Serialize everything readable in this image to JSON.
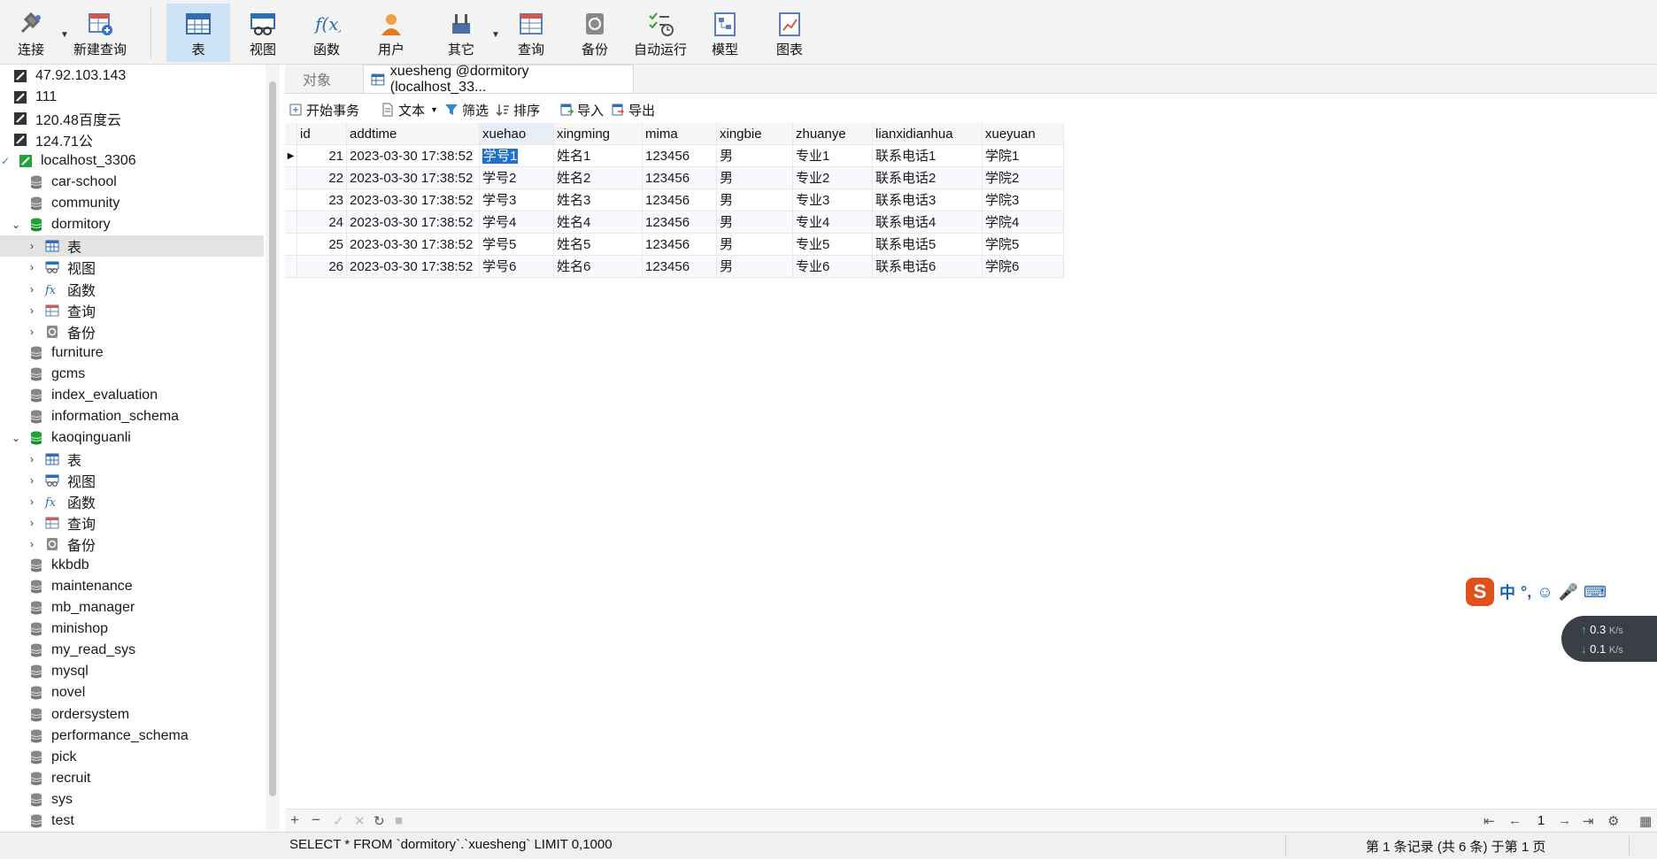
{
  "toolbar": {
    "connect": "连接",
    "new_query": "新建查询",
    "table": "表",
    "view": "视图",
    "function": "函数",
    "user": "用户",
    "other": "其它",
    "query": "查询",
    "backup": "备份",
    "autorun": "自动运行",
    "model": "模型",
    "chart": "图表"
  },
  "tree": {
    "items": [
      {
        "label": "47.92.103.143",
        "kind": "server"
      },
      {
        "label": "111",
        "kind": "server"
      },
      {
        "label": "120.48百度云",
        "kind": "server"
      },
      {
        "label": "124.71公",
        "kind": "server"
      },
      {
        "label": "localhost_3306",
        "kind": "server-open"
      },
      {
        "label": "car-school",
        "kind": "db"
      },
      {
        "label": "community",
        "kind": "db"
      },
      {
        "label": "dormitory",
        "kind": "db-open"
      },
      {
        "label": "表",
        "kind": "tables"
      },
      {
        "label": "视图",
        "kind": "views"
      },
      {
        "label": "函数",
        "kind": "functions"
      },
      {
        "label": "查询",
        "kind": "queries"
      },
      {
        "label": "备份",
        "kind": "backups"
      },
      {
        "label": "furniture",
        "kind": "db"
      },
      {
        "label": "gcms",
        "kind": "db"
      },
      {
        "label": "index_evaluation",
        "kind": "db"
      },
      {
        "label": "information_schema",
        "kind": "db"
      },
      {
        "label": "kaoqinguanli",
        "kind": "db-open"
      },
      {
        "label": "表",
        "kind": "tables"
      },
      {
        "label": "视图",
        "kind": "views"
      },
      {
        "label": "函数",
        "kind": "functions"
      },
      {
        "label": "查询",
        "kind": "queries"
      },
      {
        "label": "备份",
        "kind": "backups"
      },
      {
        "label": "kkbdb",
        "kind": "db"
      },
      {
        "label": "maintenance",
        "kind": "db"
      },
      {
        "label": "mb_manager",
        "kind": "db"
      },
      {
        "label": "minishop",
        "kind": "db"
      },
      {
        "label": "my_read_sys",
        "kind": "db"
      },
      {
        "label": "mysql",
        "kind": "db"
      },
      {
        "label": "novel",
        "kind": "db"
      },
      {
        "label": "ordersystem",
        "kind": "db"
      },
      {
        "label": "performance_schema",
        "kind": "db"
      },
      {
        "label": "pick",
        "kind": "db"
      },
      {
        "label": "recruit",
        "kind": "db"
      },
      {
        "label": "sys",
        "kind": "db"
      },
      {
        "label": "test",
        "kind": "db"
      }
    ]
  },
  "tabs": {
    "objects": "对象",
    "active": "xuesheng @dormitory (localhost_33..."
  },
  "table_toolbar": {
    "begin_tx": "开始事务",
    "text": "文本",
    "filter": "筛选",
    "sort": "排序",
    "import": "导入",
    "export": "导出"
  },
  "grid": {
    "columns": [
      "id",
      "addtime",
      "xuehao",
      "xingming",
      "mima",
      "xingbie",
      "zhuanye",
      "lianxidianhua",
      "xueyuan"
    ],
    "rows": [
      [
        "21",
        "2023-03-30 17:38:52",
        "学号1",
        "姓名1",
        "123456",
        "男",
        "专业1",
        "联系电话1",
        "学院1"
      ],
      [
        "22",
        "2023-03-30 17:38:52",
        "学号2",
        "姓名2",
        "123456",
        "男",
        "专业2",
        "联系电话2",
        "学院2"
      ],
      [
        "23",
        "2023-03-30 17:38:52",
        "学号3",
        "姓名3",
        "123456",
        "男",
        "专业3",
        "联系电话3",
        "学院3"
      ],
      [
        "24",
        "2023-03-30 17:38:52",
        "学号4",
        "姓名4",
        "123456",
        "男",
        "专业4",
        "联系电话4",
        "学院4"
      ],
      [
        "25",
        "2023-03-30 17:38:52",
        "学号5",
        "姓名5",
        "123456",
        "男",
        "专业5",
        "联系电话5",
        "学院5"
      ],
      [
        "26",
        "2023-03-30 17:38:52",
        "学号6",
        "姓名6",
        "123456",
        "男",
        "专业6",
        "联系电话6",
        "学院6"
      ]
    ]
  },
  "nav": {
    "page": "1"
  },
  "status": {
    "sql": "SELECT * FROM `dormitory`.`xuesheng` LIMIT 0,1000",
    "records": "第 1 条记录 (共 6 条) 于第 1 页"
  },
  "ime": {
    "lang": "中",
    "up": "0.3",
    "down": "0.1",
    "unit": "K/s"
  },
  "colors": {
    "accent": "#1f6fcc",
    "db_open": "#22a33a",
    "toolbar_active": "#cfe3f7"
  }
}
